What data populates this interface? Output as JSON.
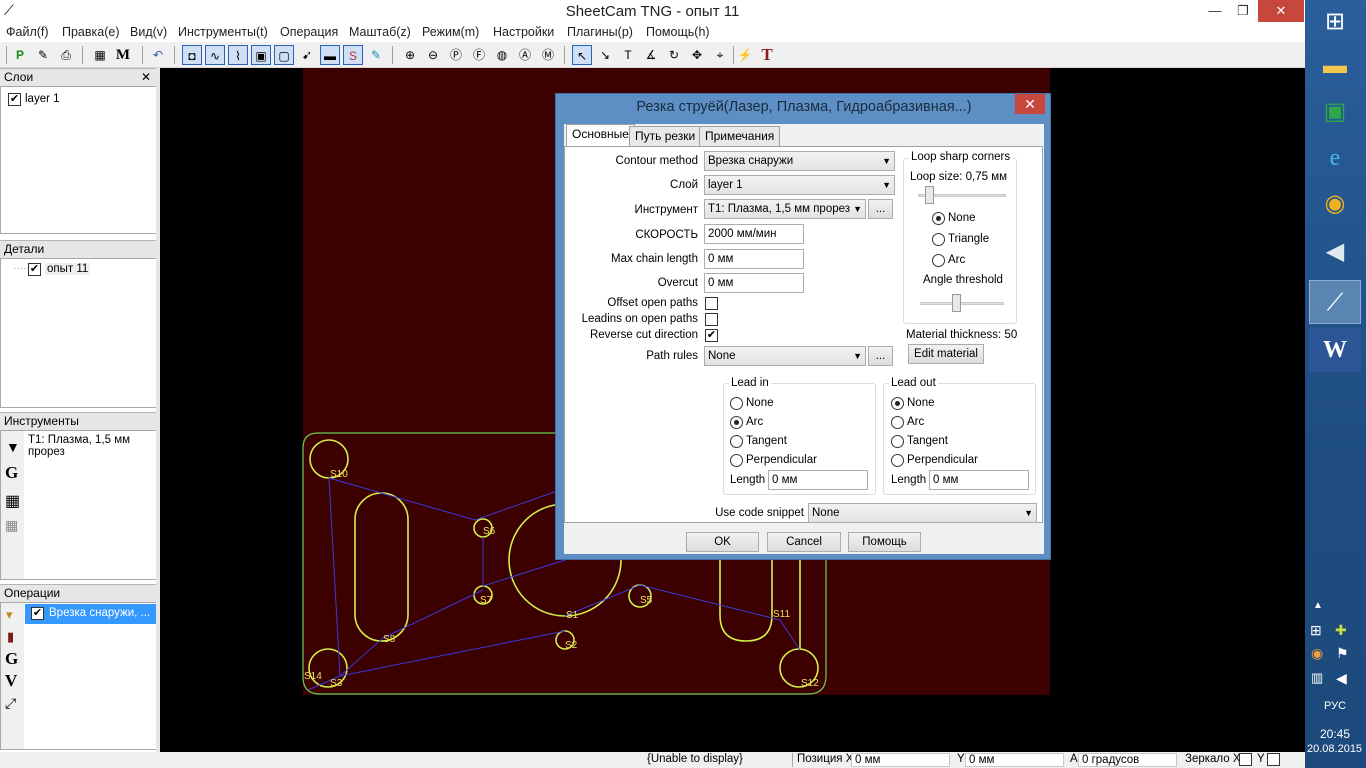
{
  "app": {
    "title": "SheetCam TNG - опыт 11"
  },
  "menu": [
    "Файл(f)",
    "Правка(e)",
    "Вид(v)",
    "Инструменты(t)",
    "Операция",
    "Маштаб(z)",
    "Режим(m)",
    "Настройки",
    "Плагины(p)",
    "Помощь(h)"
  ],
  "panels": {
    "layers": {
      "title": "Слои",
      "items": [
        "layer 1"
      ]
    },
    "parts": {
      "title": "Детали",
      "items": [
        "опыт 11"
      ]
    },
    "tools": {
      "title": "Инструменты",
      "items": [
        "T1: Плазма, 1,5 мм прорез"
      ]
    },
    "operations": {
      "title": "Операции",
      "items": [
        "Врезка снаружи, ..."
      ]
    }
  },
  "canvas_labels": [
    "S10",
    "S6",
    "S7",
    "S8",
    "S1",
    "S2",
    "S5",
    "S11",
    "S14",
    "S3",
    "S12"
  ],
  "dialog": {
    "title": "Резка струёй(Лазер, Плазма, Гидроабразивная...)",
    "tabs": [
      "Основные",
      "Путь резки",
      "Примечания"
    ],
    "fields": {
      "contour_method": {
        "label": "Contour method",
        "value": "Врезка снаружи"
      },
      "layer": {
        "label": "Слой",
        "value": "layer 1"
      },
      "tool": {
        "label": "Инструмент",
        "value": "T1: Плазма, 1,5 мм прорез",
        "button": "..."
      },
      "speed": {
        "label": "СКОРОСТЬ",
        "value": "2000 мм/мин"
      },
      "max_chain": {
        "label": "Max chain length",
        "value": "0 мм"
      },
      "overcut": {
        "label": "Overcut",
        "value": "0 мм"
      },
      "offset_open": {
        "label": "Offset open paths",
        "checked": false
      },
      "leadins_open": {
        "label": "Leadins on open paths",
        "checked": false
      },
      "reverse": {
        "label": "Reverse cut direction",
        "checked": true
      },
      "path_rules": {
        "label": "Path rules",
        "value": "None",
        "button": "..."
      }
    },
    "loop": {
      "title": "Loop sharp corners",
      "size_label": "Loop size: 0,75 мм",
      "options": [
        "None",
        "Triangle",
        "Arc"
      ],
      "selected": "None",
      "angle_label": "Angle threshold"
    },
    "material_thickness": "Material thickness: 50 r",
    "edit_material": "Edit material",
    "lead_in": {
      "title": "Lead in",
      "options": [
        "None",
        "Arc",
        "Tangent",
        "Perpendicular"
      ],
      "selected": "Arc",
      "length_label": "Length",
      "length": "0 мм"
    },
    "lead_out": {
      "title": "Lead out",
      "options": [
        "None",
        "Arc",
        "Tangent",
        "Perpendicular"
      ],
      "selected": "None",
      "length_label": "Length",
      "length": "0 мм"
    },
    "snippet": {
      "label": "Use code snippet",
      "value": "None"
    },
    "buttons": {
      "ok": "OK",
      "cancel": "Cancel",
      "help": "Помощь"
    }
  },
  "status": {
    "message": "{Unable to display}",
    "pos_x_label": "Позиция X",
    "pos_x": "0 мм",
    "y_label": "Y",
    "y": "0 мм",
    "a_label": "A",
    "a": "0 градусов",
    "mirror_label": "Зеркало X",
    "mirror_y": "Y"
  },
  "taskbar": {
    "lang": "РУС",
    "time": "20:45",
    "date": "20.08.2015"
  },
  "colors": {
    "sheet": "#3c0000",
    "path": "#d2f048",
    "rapid": "#3a3ad8",
    "label": "#e8e060",
    "accent": "#5d8fc4"
  }
}
